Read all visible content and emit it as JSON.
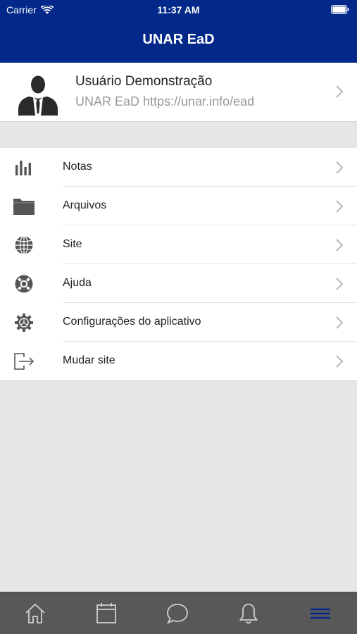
{
  "status_bar": {
    "carrier": "Carrier",
    "time": "11:37 AM",
    "wifi_icon": "wifi-icon",
    "battery_icon": "battery-icon"
  },
  "header": {
    "title": "UNAR EaD",
    "background": "#02288a"
  },
  "profile": {
    "name": "Usuário Demonstração",
    "site": "UNAR EaD https://unar.info/ead",
    "avatar_icon": "user-avatar-icon"
  },
  "menu": {
    "items": [
      {
        "label": "Notas",
        "icon": "bar-chart-icon"
      },
      {
        "label": "Arquivos",
        "icon": "folder-icon"
      },
      {
        "label": "Site",
        "icon": "globe-icon"
      },
      {
        "label": "Ajuda",
        "icon": "lifebuoy-icon"
      },
      {
        "label": "Configurações do aplicativo",
        "icon": "gear-icon"
      },
      {
        "label": "Mudar site",
        "icon": "logout-icon"
      }
    ]
  },
  "tab_bar": {
    "tabs": [
      {
        "icon": "home-icon",
        "active": false
      },
      {
        "icon": "calendar-icon",
        "active": false
      },
      {
        "icon": "chat-icon",
        "active": false
      },
      {
        "icon": "bell-icon",
        "active": false
      },
      {
        "icon": "menu-icon",
        "active": true
      }
    ],
    "active_color": "#02288a",
    "inactive_color": "#cfcfcf"
  }
}
